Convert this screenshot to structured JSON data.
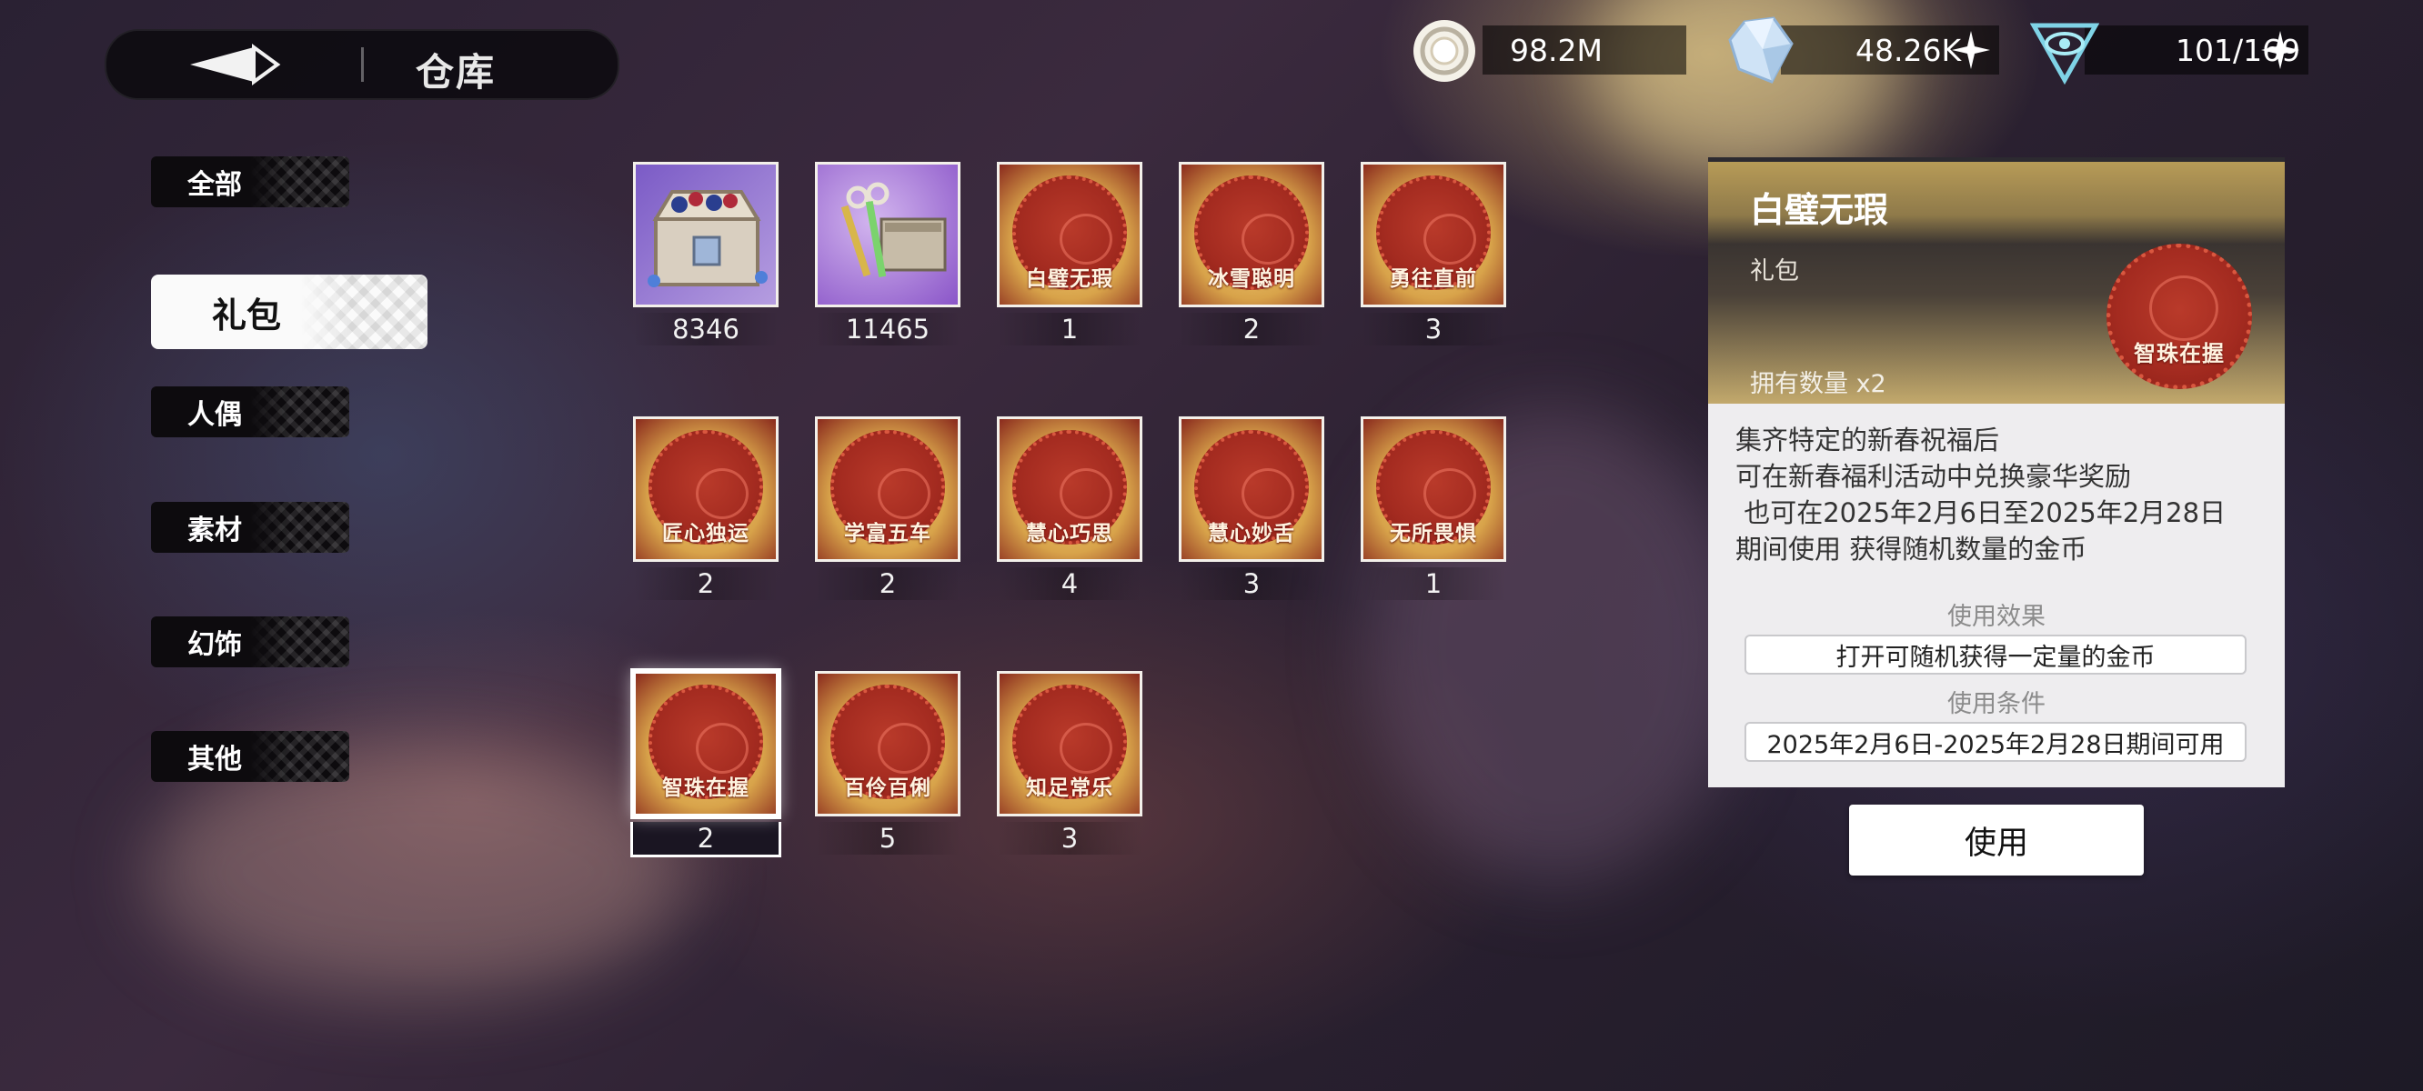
{
  "header": {
    "title": "仓库",
    "back_icon": "back-arrow-icon"
  },
  "currencies": [
    {
      "icon": "coin-icon",
      "value": "98.2M",
      "has_plus": false
    },
    {
      "icon": "crystal-icon",
      "value": "48.26K",
      "has_plus": true
    },
    {
      "icon": "stamina-eye-icon",
      "value": "101/169",
      "has_plus": true
    }
  ],
  "categories": [
    {
      "label": "全部",
      "active": false
    },
    {
      "label": "礼包",
      "active": true
    },
    {
      "label": "人偶",
      "active": false
    },
    {
      "label": "素材",
      "active": false
    },
    {
      "label": "幻饰",
      "active": false
    },
    {
      "label": "其他",
      "active": false
    }
  ],
  "items": [
    {
      "kind": "chest",
      "label": "",
      "count": "8346"
    },
    {
      "kind": "keys",
      "label": "",
      "count": "11465"
    },
    {
      "kind": "stamp",
      "label": "白璧无瑕",
      "count": "1"
    },
    {
      "kind": "stamp",
      "label": "冰雪聪明",
      "count": "2"
    },
    {
      "kind": "stamp",
      "label": "勇往直前",
      "count": "3"
    },
    {
      "kind": "stamp",
      "label": "匠心独运",
      "count": "2"
    },
    {
      "kind": "stamp",
      "label": "学富五车",
      "count": "2"
    },
    {
      "kind": "stamp",
      "label": "慧心巧思",
      "count": "4"
    },
    {
      "kind": "stamp",
      "label": "慧心妙舌",
      "count": "3"
    },
    {
      "kind": "stamp",
      "label": "无所畏惧",
      "count": "1"
    },
    {
      "kind": "stamp",
      "label": "智珠在握",
      "count": "2",
      "selected": true
    },
    {
      "kind": "stamp",
      "label": "百伶百俐",
      "count": "5"
    },
    {
      "kind": "stamp",
      "label": "知足常乐",
      "count": "3"
    }
  ],
  "detail": {
    "title": "白璧无瑕",
    "type": "礼包",
    "owned": "拥有数量 x2",
    "stamp_label": "智珠在握",
    "description": [
      "集齐特定的新春祝福后",
      "可在新春福利活动中兑换豪华奖励",
      " 也可在2025年2月6日至2025年2月28日",
      "期间使用 获得随机数量的金币"
    ],
    "effect_label": "使用效果",
    "effect_value": "打开可随机获得一定量的金币",
    "condition_label": "使用条件",
    "condition_value": "2025年2月6日-2025年2月28日期间可用",
    "use_button": "使用"
  },
  "colors": {
    "stamp_red": "#a42b20",
    "panel_gold": "#b79b57",
    "panel_bg": "#eeedef"
  }
}
